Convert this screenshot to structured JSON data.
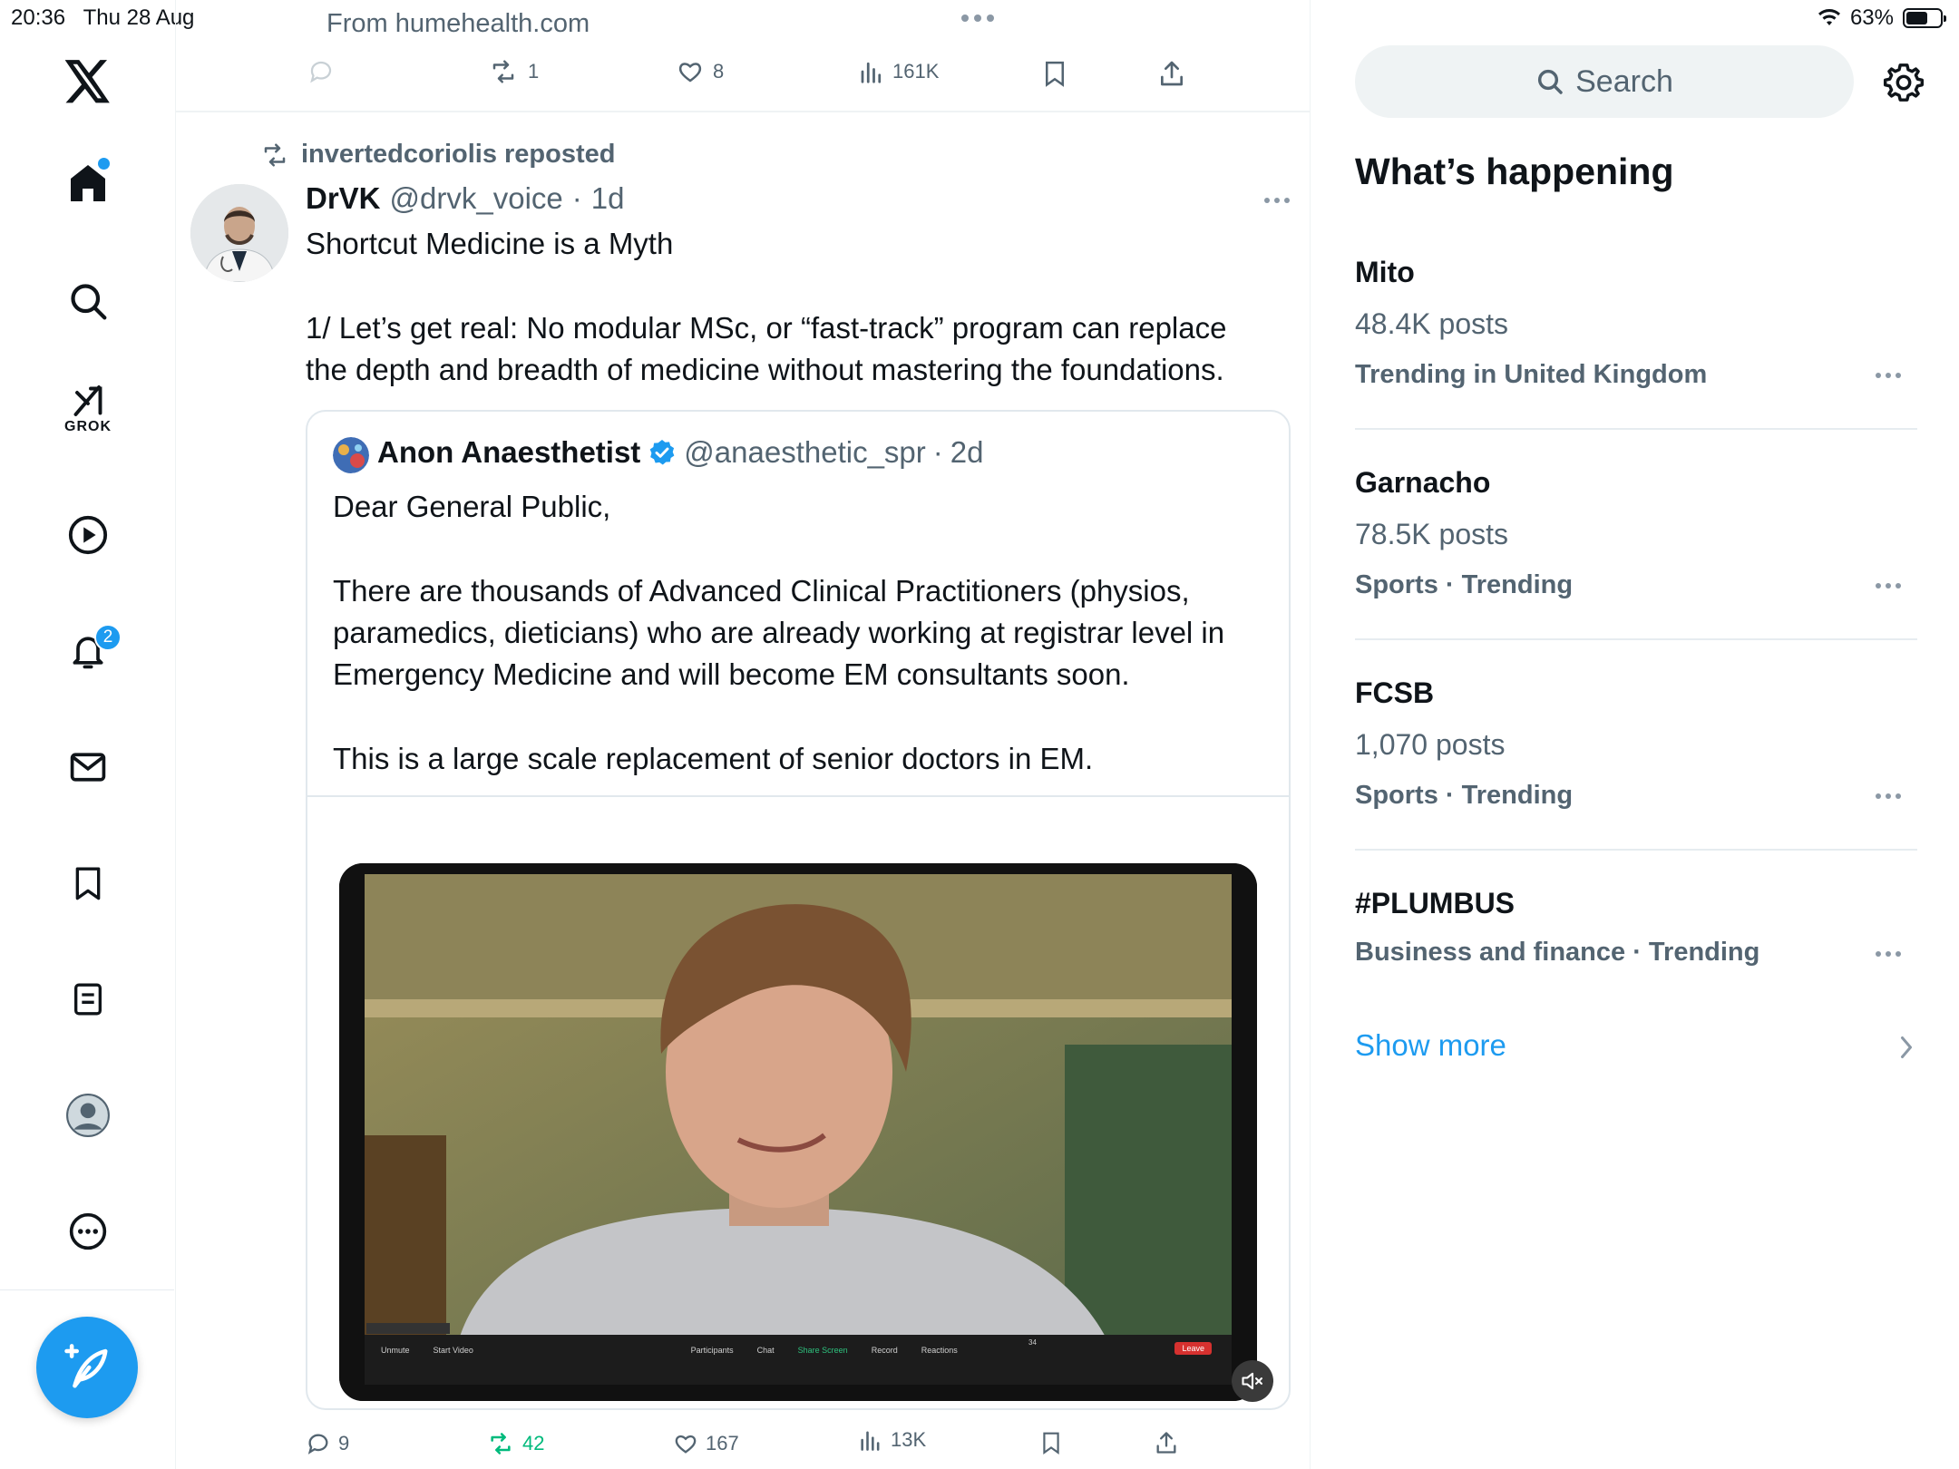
{
  "status_bar": {
    "time": "20:36",
    "date": "Thu 28 Aug",
    "battery": "63%",
    "battery_level": 0.63
  },
  "nav": {
    "grok_label": "GROK",
    "notifications_badge": "2"
  },
  "prev_tweet": {
    "source": "From humehealth.com",
    "retweets": "1",
    "likes": "8",
    "views": "161K"
  },
  "tweet": {
    "repost_label": "invertedcoriolis reposted",
    "author_name": "DrVK",
    "author_handle": "@drvk_voice",
    "time": "1d",
    "title_line": "Shortcut Medicine is a Myth",
    "body_line1": "1/ Let’s get real: No modular MSc, or “fast-track” program can replace",
    "body_line2": "the depth and breadth of medicine without mastering the foundations.",
    "replies": "9",
    "retweets": "42",
    "likes": "167",
    "views": "13K"
  },
  "quoted": {
    "author_name": "Anon Anaesthetist",
    "author_handle": "@anaesthetic_spr",
    "time": "2d",
    "line1": "Dear General Public,",
    "line2": "There are thousands of Advanced Clinical Practitioners (physios,",
    "line3": "paramedics, dieticians) who are already working at registrar level in",
    "line4": "Emergency Medicine and will become EM consultants soon.",
    "line5": "This is a large scale replacement of senior doctors in EM."
  },
  "video_toolbar": {
    "unmute": "Unmute",
    "start_video": "Start Video",
    "participants": "Participants",
    "participants_count": "34",
    "chat": "Chat",
    "share_screen": "Share Screen",
    "record": "Record",
    "reactions": "Reactions",
    "leave": "Leave"
  },
  "sidebar": {
    "search_placeholder": "Search",
    "heading": "What’s happening",
    "trends": [
      {
        "name": "Mito",
        "posts": "48.4K posts",
        "meta": "Trending in United Kingdom"
      },
      {
        "name": "Garnacho",
        "posts": "78.5K posts",
        "meta": "Sports · Trending"
      },
      {
        "name": "FCSB",
        "posts": "1,070 posts",
        "meta": "Sports · Trending"
      },
      {
        "name": "#PLUMBUS",
        "posts": "",
        "meta": "Business and finance · Trending"
      }
    ],
    "show_more": "Show more"
  },
  "colors": {
    "accent": "#1d9bf0",
    "text": "#0f1419",
    "muted": "#536471",
    "retweet_green": "#00ba7c"
  }
}
